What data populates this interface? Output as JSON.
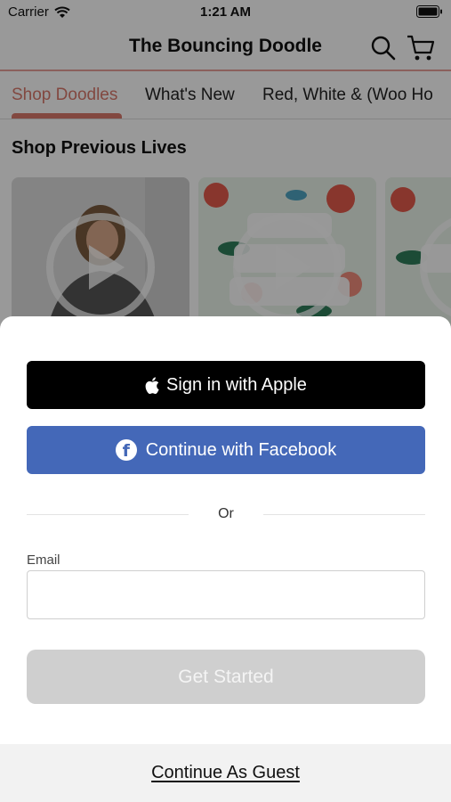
{
  "status_bar": {
    "carrier": "Carrier",
    "time": "1:21 AM"
  },
  "header": {
    "title": "The Bouncing Doodle",
    "search_icon": "search-icon",
    "cart_icon": "cart-icon"
  },
  "tabs": [
    {
      "label": "Shop Doodles",
      "active": true
    },
    {
      "label": "What's New",
      "active": false
    },
    {
      "label": "Red, White & (Woo Ho",
      "active": false
    }
  ],
  "section": {
    "title": "Shop Previous Lives"
  },
  "sheet": {
    "apple_label": "Sign in with Apple",
    "facebook_label": "Continue with Facebook",
    "divider_text": "Or",
    "email_label": "Email",
    "email_value": "",
    "get_started_label": "Get Started",
    "guest_label": "Continue As Guest"
  },
  "colors": {
    "accent": "#d9796c",
    "facebook": "#4468b8",
    "apple": "#000000",
    "disabled_button": "#cfcfcf"
  }
}
